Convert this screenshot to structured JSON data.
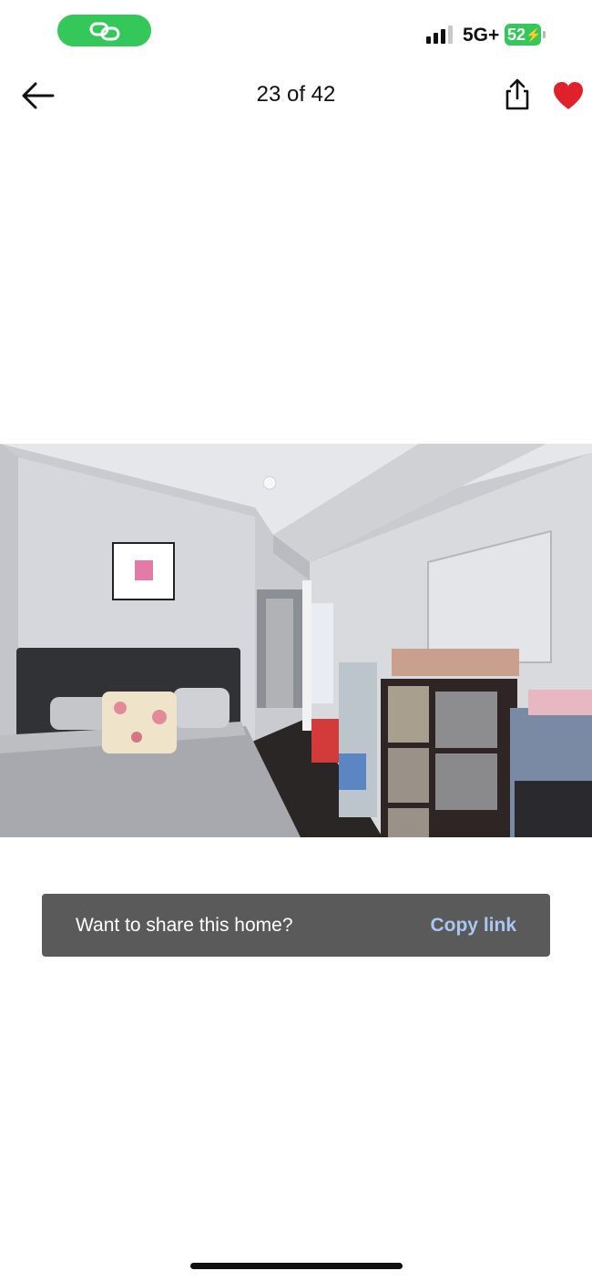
{
  "status_bar": {
    "network": "5G+",
    "battery_level": "52",
    "battery_symbol": "⚡",
    "pill_icon": "link-icon"
  },
  "header": {
    "counter": "23 of 42",
    "back_icon": "arrow-left-icon",
    "share_icon": "share-icon",
    "favorite_icon": "heart-icon",
    "favorite_color": "#e0202a"
  },
  "photo": {
    "icon": "bedroom-photo"
  },
  "toast": {
    "message": "Want to share this home?",
    "action": "Copy link",
    "action_color": "#a9c7f2"
  },
  "colors": {
    "status_green": "#34c759",
    "toast_bg": "#5a5a5a"
  }
}
